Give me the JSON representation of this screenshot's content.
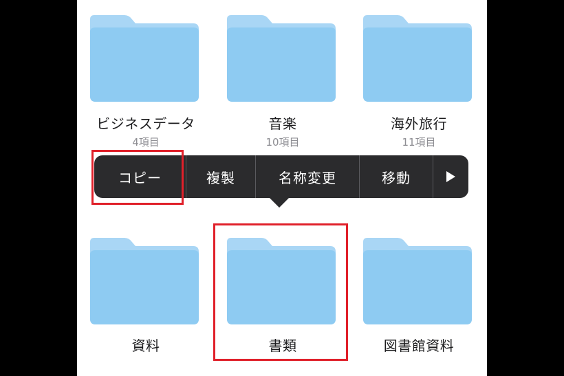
{
  "colors": {
    "folder_back": "#a9d6f5",
    "folder_front": "#8ecbf2",
    "menu_background": "#2b2b2d",
    "highlight": "#e0202a"
  },
  "folders": [
    {
      "name": "ビジネスデータ",
      "count": "4項目",
      "icon": "folder-icon"
    },
    {
      "name": "音楽",
      "count": "10項目",
      "icon": "folder-icon"
    },
    {
      "name": "海外旅行",
      "count": "11項目",
      "icon": "folder-icon"
    },
    {
      "name": "資料",
      "icon": "folder-icon"
    },
    {
      "name": "書類",
      "icon": "folder-icon"
    },
    {
      "name": "図書館資料",
      "icon": "folder-icon"
    }
  ],
  "context_menu": {
    "items": [
      "コピー",
      "複製",
      "名称変更",
      "移動"
    ],
    "more_icon": "play-arrow-icon"
  }
}
